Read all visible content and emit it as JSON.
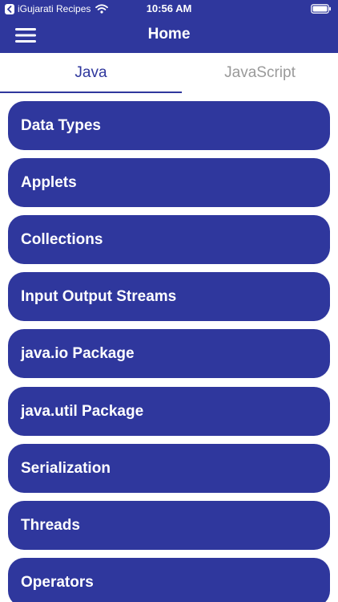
{
  "status_bar": {
    "back_app": "iGujarati Recipes",
    "time": "10:56 AM",
    "icons": [
      "back-chevron-icon",
      "wifi-icon",
      "battery-icon"
    ]
  },
  "nav_bar": {
    "title": "Home",
    "menu_icon": "hamburger-menu-icon"
  },
  "tabs": [
    {
      "label": "Java",
      "selected": true
    },
    {
      "label": "JavaScript",
      "selected": false
    }
  ],
  "topics": [
    {
      "label": "Data Types"
    },
    {
      "label": "Applets"
    },
    {
      "label": "Collections"
    },
    {
      "label": "Input Output Streams"
    },
    {
      "label": "java.io Package"
    },
    {
      "label": "java.util Package"
    },
    {
      "label": "Serialization"
    },
    {
      "label": "Threads"
    },
    {
      "label": "Operators"
    }
  ],
  "colors": {
    "primary": "#2f379d",
    "text_on_primary": "#ffffff",
    "tab_inactive": "#9a9a9a"
  }
}
